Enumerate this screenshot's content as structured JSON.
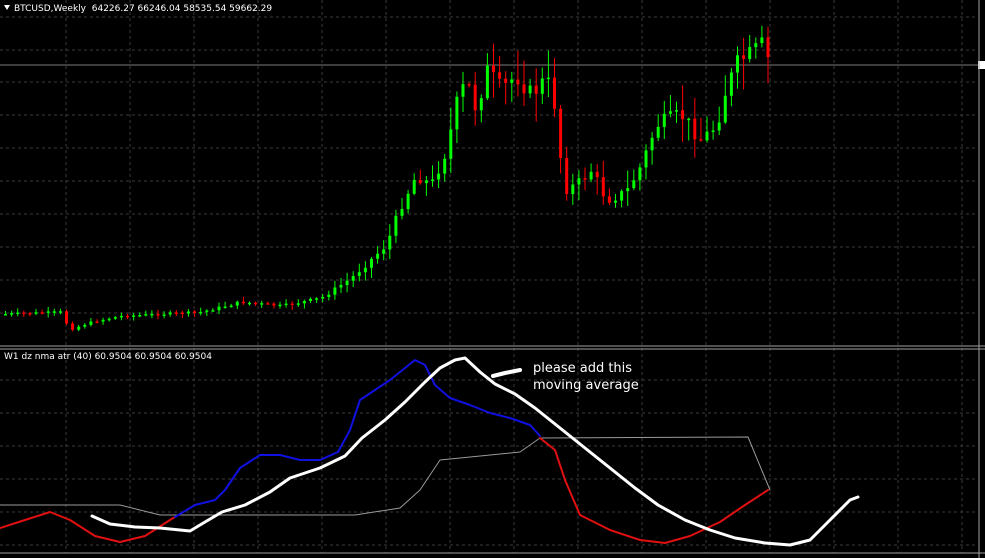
{
  "main_pane": {
    "symbol": "BTCUSD,Weekly",
    "ohlc": "64226.27 66246.04 58535.54 59662.29"
  },
  "indicator_pane": {
    "label": "W1 dz nma atr (40) 60.9504 60.9504 60.9504",
    "annotation_line1": "please add this",
    "annotation_line2": "moving average"
  },
  "colors": {
    "background": "#000000",
    "bull": "#00ff00",
    "bear": "#ff0000",
    "grid": "#3a3a3a",
    "nma_up": "#1010e0",
    "nma_down": "#e01010",
    "hand_drawn": "#ffffff",
    "atr_band": "#9a9a9a"
  },
  "icons": {
    "collapse": "triangle-down-icon"
  }
}
